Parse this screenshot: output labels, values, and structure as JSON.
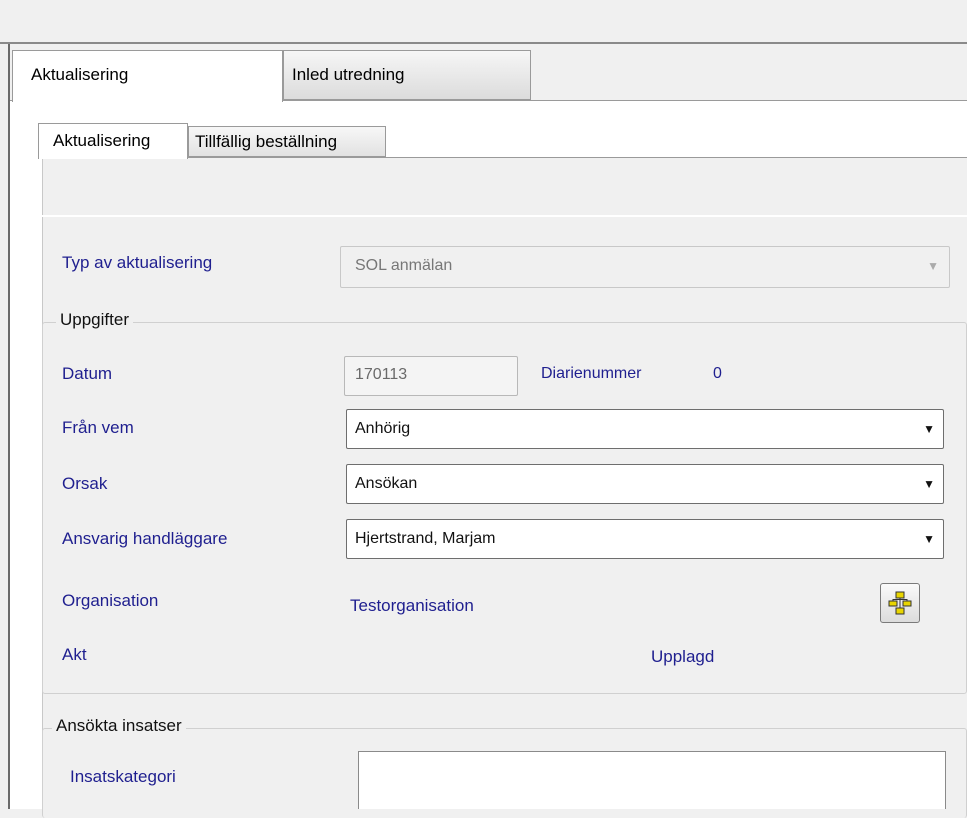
{
  "tabs": {
    "main_active": "Aktualisering",
    "main_other": "Inled utredning"
  },
  "inner_tabs": {
    "active": "Aktualisering",
    "other": "Tillfällig beställning"
  },
  "typ": {
    "label": "Typ av aktualisering",
    "value": "SOL anmälan"
  },
  "uppgifter": {
    "title": "Uppgifter",
    "datum_label": "Datum",
    "datum_value": "170113",
    "diarienummer_label": "Diarienummer",
    "diarienummer_value": "0",
    "fran_vem_label": "Från vem",
    "fran_vem_value": "Anhörig",
    "orsak_label": "Orsak",
    "orsak_value": "Ansökan",
    "handlaggare_label": "Ansvarig handläggare",
    "handlaggare_value": "Hjertstrand, Marjam",
    "organisation_label": "Organisation",
    "organisation_value": "Testorganisation",
    "akt_label": "Akt",
    "akt_value": "Upplagd"
  },
  "ansokta": {
    "title": "Ansökta insatser",
    "insatskategori_label": "Insatskategori"
  },
  "icons": {
    "dropdown": "chevron-down-icon",
    "org_tree": "org-tree-icon"
  }
}
